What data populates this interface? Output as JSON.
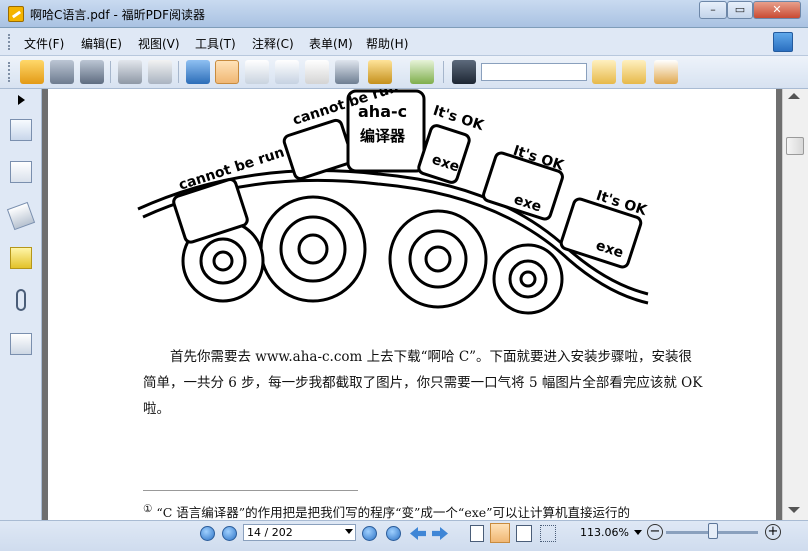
{
  "window": {
    "title": "啊哈C语言.pdf - 福昕PDF阅读器"
  },
  "menu": [
    {
      "label": "文件(F)"
    },
    {
      "label": "编辑(E)"
    },
    {
      "label": "视图(V)"
    },
    {
      "label": "工具(T)"
    },
    {
      "label": "注释(C)"
    },
    {
      "label": "表单(M)"
    },
    {
      "label": "帮助(H)"
    }
  ],
  "toolbar": {
    "search_value": ""
  },
  "illustration": {
    "compiler_label_1": "aha-c",
    "compiler_label_2": "编译器",
    "cannot_run": "cannot\nbe run",
    "cannot_run_top": "cannot\nbe run",
    "its_ok": "It's OK",
    "exe": "exe"
  },
  "document": {
    "paragraph_1": "首先你需要去 www.aha-c.com 上去下载“啊哈 C”。下面就要进入安装步骤啦，安装很简单，一共分 6 步，每一步我都截取了图片，你只需要一口气将 5 幅图片全部看完应该就 OK 啦。",
    "footnote_marker": "①",
    "footnote": "“C 语言编译器”的作用把是把我们写的程序“变”成一个“exe”可以让计算机直接运行的"
  },
  "status": {
    "page_field": "14 / 202",
    "zoom": "113.06%"
  },
  "colors": {
    "accent": "#2f74c6",
    "page_bg": "#ffffff",
    "viewer_bg": "#6f6f6f"
  }
}
